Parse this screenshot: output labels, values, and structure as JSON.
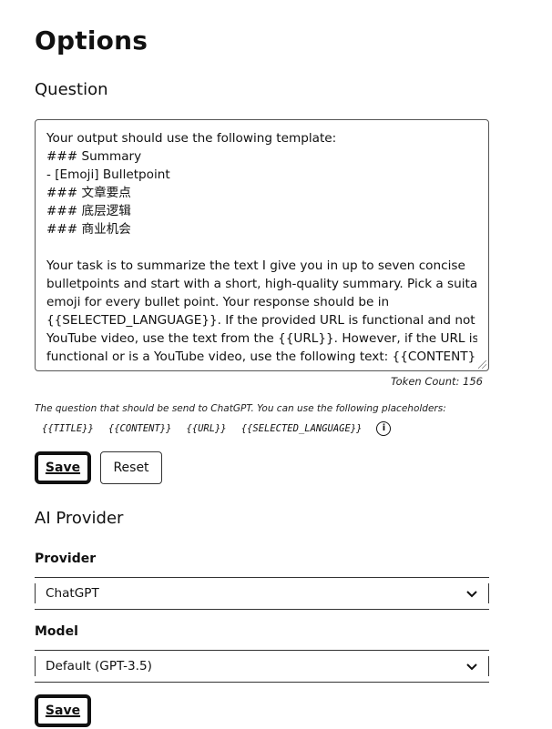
{
  "page": {
    "title": "Options"
  },
  "question": {
    "section_title": "Question",
    "prompt_lines": [
      "Your output should use the following template:",
      "### Summary",
      "- [Emoji] Bulletpoint",
      "### 文章要点",
      "### 底层逻辑",
      "### 商业机会",
      "",
      "Your task is to summarize the text I give you in up to seven concise",
      "bulletpoints and start with a short, high-quality summary. Pick a suitable",
      "emoji for every bullet point. Your response should be in",
      "{{SELECTED_LANGUAGE}}. If the provided URL is functional and not a",
      "YouTube video, use the text from the {{URL}}. However, if the URL is not",
      "functional or is a YouTube video, use the following text: {{CONTENT}}."
    ],
    "token_count": "Token Count: 156",
    "hint": "The question that should be send to ChatGPT. You can use the following placeholders:",
    "placeholders": [
      "{{TITLE}}",
      "{{CONTENT}}",
      "{{URL}}",
      "{{SELECTED_LANGUAGE}}"
    ],
    "info_icon": "info-icon",
    "save_label": "Save",
    "reset_label": "Reset"
  },
  "ai_provider": {
    "section_title": "AI Provider",
    "provider_label": "Provider",
    "provider_value": "ChatGPT",
    "model_label": "Model",
    "model_value": "Default (GPT-3.5)",
    "save_label": "Save"
  }
}
